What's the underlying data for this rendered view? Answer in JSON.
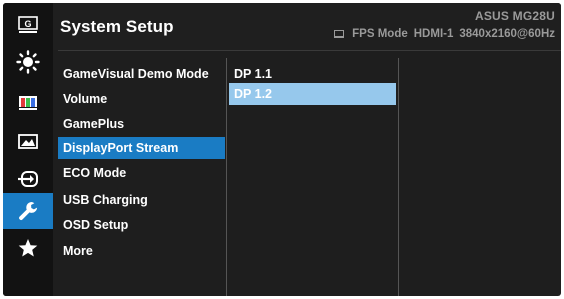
{
  "header": {
    "title": "System Setup",
    "model": "ASUS  MG28U",
    "status": {
      "mode": "FPS Mode",
      "input": "HDMI-1",
      "resolution": "3840x2160@60Hz"
    }
  },
  "icons": [
    {
      "name": "gamevisual-icon",
      "active": false
    },
    {
      "name": "brightness-icon",
      "active": false
    },
    {
      "name": "color-icon",
      "active": false
    },
    {
      "name": "image-icon",
      "active": false
    },
    {
      "name": "input-select-icon",
      "active": false
    },
    {
      "name": "system-setup-wrench-icon",
      "active": true
    },
    {
      "name": "favorite-star-icon",
      "active": false
    }
  ],
  "menu": {
    "items": [
      {
        "label": "GameVisual Demo Mode",
        "selected": false
      },
      {
        "label": "Volume",
        "selected": false
      },
      {
        "label": "GamePlus",
        "selected": false
      },
      {
        "label": "DisplayPort Stream",
        "selected": true
      },
      {
        "label": "ECO Mode",
        "selected": false
      },
      {
        "label": "USB Charging",
        "selected": false
      },
      {
        "label": "OSD Setup",
        "selected": false
      },
      {
        "label": "More",
        "selected": false
      }
    ]
  },
  "submenu": {
    "items": [
      {
        "label": "DP 1.1",
        "selected": false
      },
      {
        "label": "DP 1.2",
        "selected": true
      }
    ]
  },
  "colors": {
    "accent": "#1a7cc4",
    "sub_highlight": "#96c8ec",
    "background": "#1e1e1e"
  }
}
